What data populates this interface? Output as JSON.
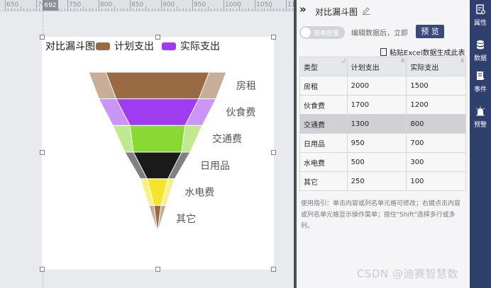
{
  "ruler": {
    "ticks": [
      "650",
      "700",
      "750",
      "800",
      "850",
      "900",
      "950",
      "1000",
      "1050",
      "1100"
    ],
    "marker": "692"
  },
  "chart": {
    "title": "对比漏斗图"
  },
  "chart_data": {
    "type": "funnel",
    "title": "对比漏斗图",
    "series": [
      {
        "name": "计划支出",
        "color": "#9a6a44",
        "values": [
          2000,
          1700,
          1300,
          950,
          500,
          250
        ]
      },
      {
        "name": "实际支出",
        "color": "#a03cf0",
        "values": [
          1500,
          1200,
          800,
          700,
          300,
          100
        ]
      }
    ],
    "categories": [
      "房租",
      "伙食费",
      "交通费",
      "日用品",
      "水电费",
      "其它"
    ],
    "category_colors": [
      "#9a6a44",
      "#a03cf0",
      "#8ad834",
      "#1a1a1a",
      "#f4e42a",
      "#9a6a44"
    ]
  },
  "panel": {
    "title": "对比漏斗图",
    "toggle_label": "简单配置",
    "hint": "编辑数据后，立即",
    "preview_label": "预 览",
    "paste_label": "粘贴Excel数据生成此表",
    "table": {
      "headers": [
        "类型",
        "计划支出",
        "实际支出"
      ],
      "rows": [
        [
          "房租",
          "2000",
          "1500"
        ],
        [
          "伙食费",
          "1700",
          "1200"
        ],
        [
          "交通费",
          "1300",
          "800"
        ],
        [
          "日用品",
          "950",
          "700"
        ],
        [
          "水电费",
          "500",
          "300"
        ],
        [
          "其它",
          "250",
          "100"
        ]
      ]
    },
    "usage": "使用指引：单击内容或列名单元格可修改；右键点击内容或列名单元格显示操作菜单；按住\"Shift\"选择多行或多列。"
  },
  "sidebar": {
    "items": [
      {
        "label": "属性",
        "icon": "properties-icon"
      },
      {
        "label": "数据",
        "icon": "database-icon"
      },
      {
        "label": "事件",
        "icon": "event-icon"
      },
      {
        "label": "预警",
        "icon": "alarm-icon"
      }
    ]
  },
  "watermark": "CSDN @迪赛智慧数"
}
